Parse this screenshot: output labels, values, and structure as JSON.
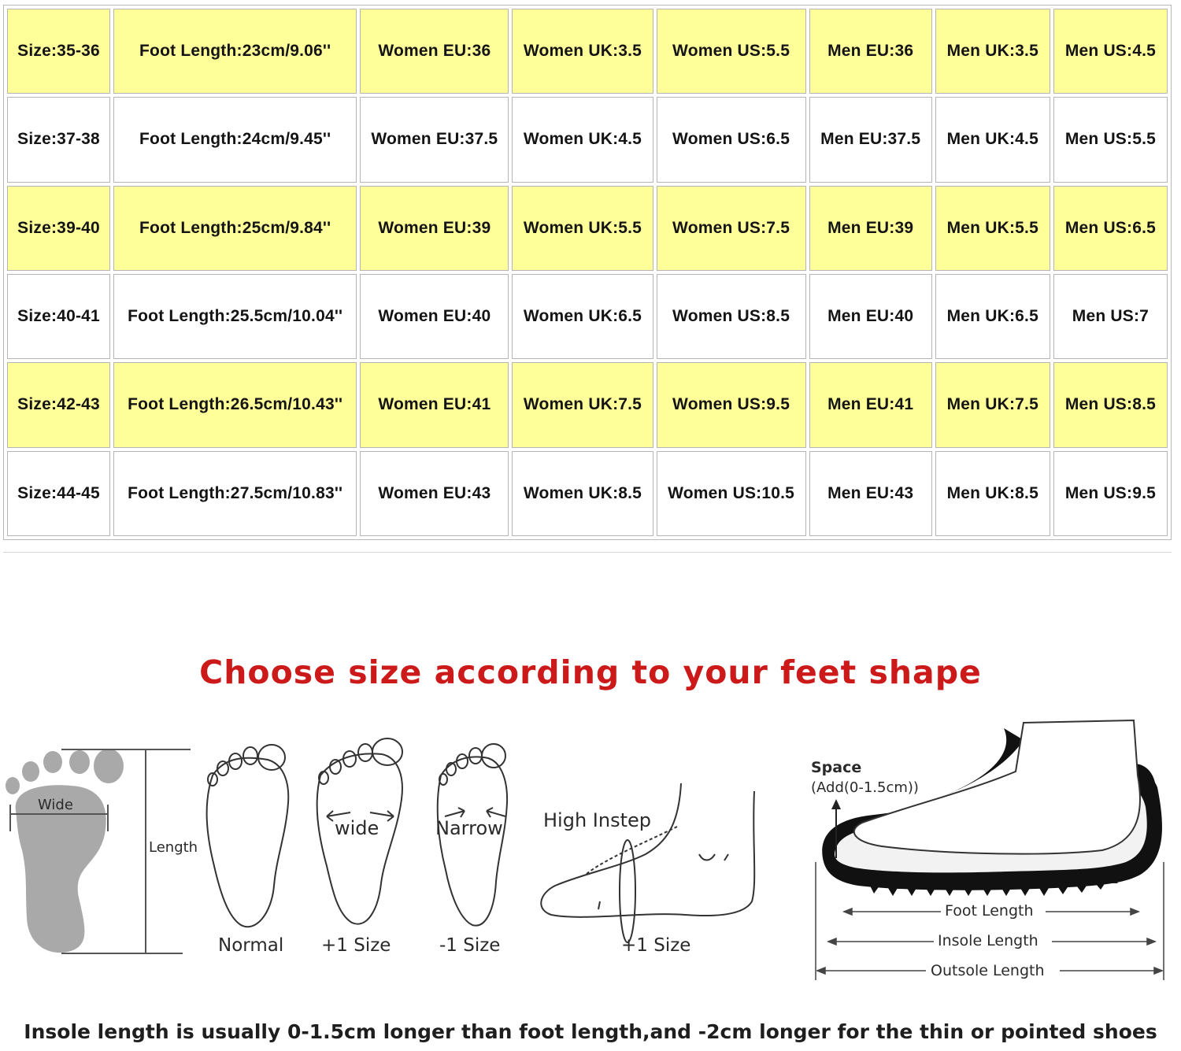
{
  "size_chart": {
    "rows": [
      [
        "Size:35-36",
        "Foot Length:23cm/9.06''",
        "Women EU:36",
        "Women UK:3.5",
        "Women US:5.5",
        "Men EU:36",
        "Men UK:3.5",
        "Men US:4.5"
      ],
      [
        "Size:37-38",
        "Foot Length:24cm/9.45''",
        "Women EU:37.5",
        "Women UK:4.5",
        "Women US:6.5",
        "Men EU:37.5",
        "Men UK:4.5",
        "Men US:5.5"
      ],
      [
        "Size:39-40",
        "Foot Length:25cm/9.84''",
        "Women EU:39",
        "Women UK:5.5",
        "Women US:7.5",
        "Men EU:39",
        "Men UK:5.5",
        "Men US:6.5"
      ],
      [
        "Size:40-41",
        "Foot Length:25.5cm/10.04''",
        "Women EU:40",
        "Women UK:6.5",
        "Women US:8.5",
        "Men EU:40",
        "Men UK:6.5",
        "Men US:7"
      ],
      [
        "Size:42-43",
        "Foot Length:26.5cm/10.43''",
        "Women EU:41",
        "Women UK:7.5",
        "Women US:9.5",
        "Men EU:41",
        "Men UK:7.5",
        "Men US:8.5"
      ],
      [
        "Size:44-45",
        "Foot Length:27.5cm/10.83''",
        "Women EU:43",
        "Women UK:8.5",
        "Women US:10.5",
        "Men EU:43",
        "Men UK:8.5",
        "Men US:9.5"
      ]
    ],
    "highlight_color": "#ffff9a"
  },
  "guide": {
    "heading": "Choose size according to your feet shape",
    "heading_color": "#cc1a1a",
    "measure": {
      "wide": "Wide",
      "length": "Length"
    },
    "shapes": [
      {
        "note": "",
        "caption": "Normal"
      },
      {
        "note": "wide",
        "caption": "+1 Size"
      },
      {
        "note": "Narrow",
        "caption": "-1 Size"
      },
      {
        "note": "High Instep",
        "caption": "+1 Size"
      }
    ],
    "shoe": {
      "space_label": "Space",
      "space_note": "(Add(0-1.5cm))",
      "foot_length": "Foot Length",
      "insole_length": "Insole Length",
      "outsole_length": "Outsole Length"
    },
    "footnote": "Insole length is usually 0-1.5cm longer than foot length,and -2cm longer for the thin or pointed shoes"
  }
}
